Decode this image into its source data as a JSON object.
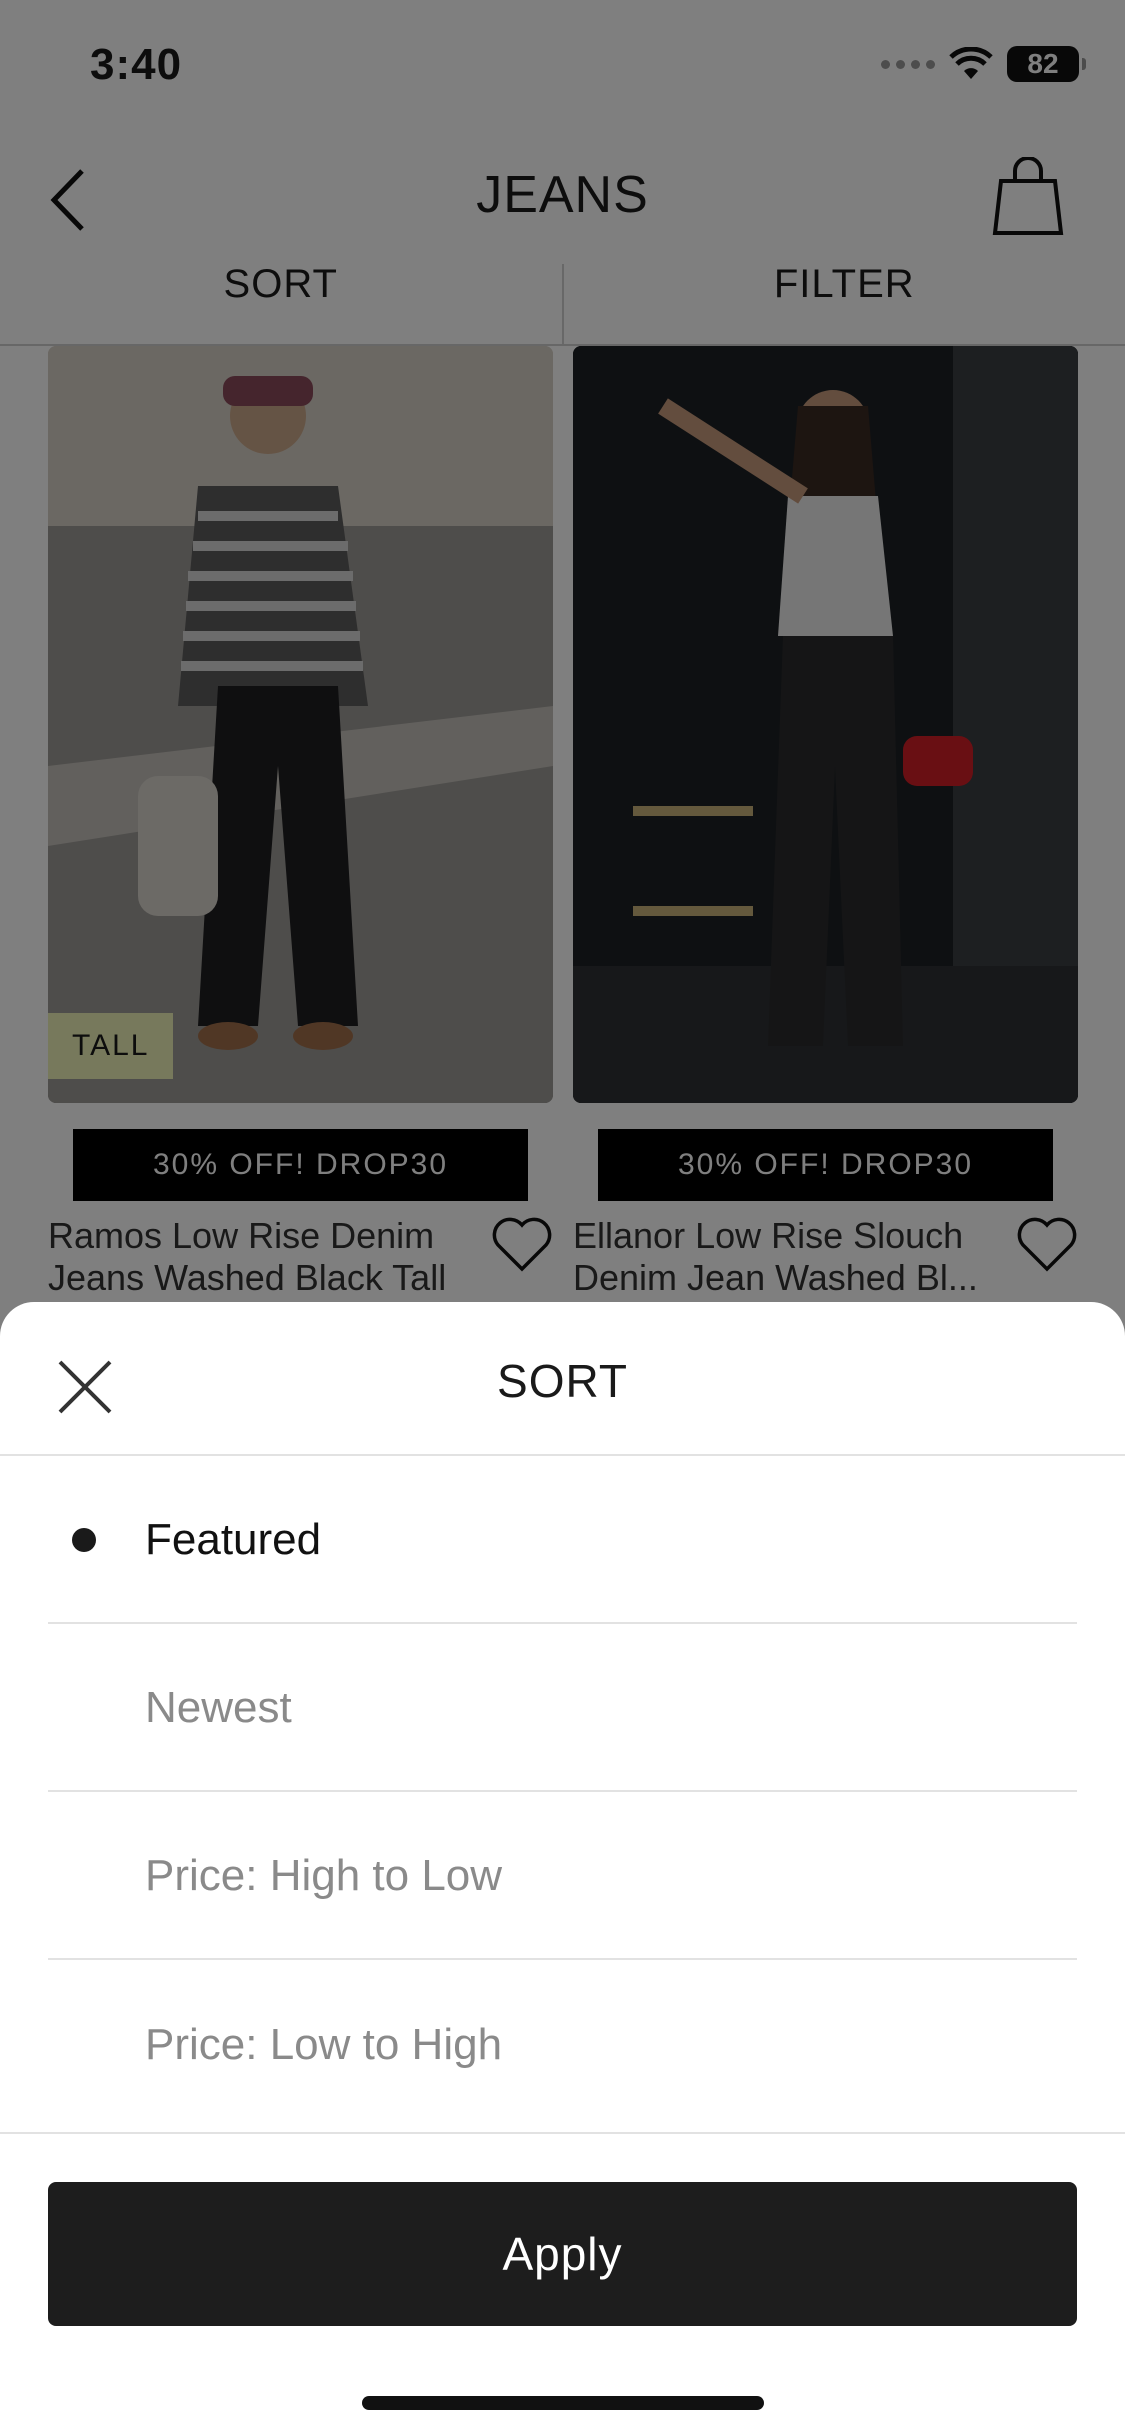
{
  "status_bar": {
    "time": "3:40",
    "battery": "82"
  },
  "nav": {
    "title": "JEANS"
  },
  "tabs": {
    "sort": "SORT",
    "filter": "FILTER"
  },
  "products": [
    {
      "name": "Ramos Low Rise Denim Jeans Washed Black Tall",
      "promo": "30% OFF! DROP30",
      "badge": "TALL"
    },
    {
      "name": "Ellanor Low Rise Slouch Denim Jean Washed Bl...",
      "promo": "30% OFF! DROP30"
    }
  ],
  "sort_sheet": {
    "title": "SORT",
    "options": [
      {
        "label": "Featured",
        "selected": true
      },
      {
        "label": "Newest",
        "selected": false
      },
      {
        "label": "Price: High to Low",
        "selected": false
      },
      {
        "label": "Price: Low to High",
        "selected": false
      }
    ],
    "apply_label": "Apply"
  },
  "icons": {
    "back": "chevron-left-icon",
    "bag": "shopping-bag-icon",
    "heart": "heart-icon",
    "close": "close-icon",
    "wifi": "wifi-icon",
    "battery": "battery-icon"
  },
  "colors": {
    "overlay": "#000000",
    "apply_button": "#1d1d1d",
    "tall_badge": "#eef2b8"
  }
}
